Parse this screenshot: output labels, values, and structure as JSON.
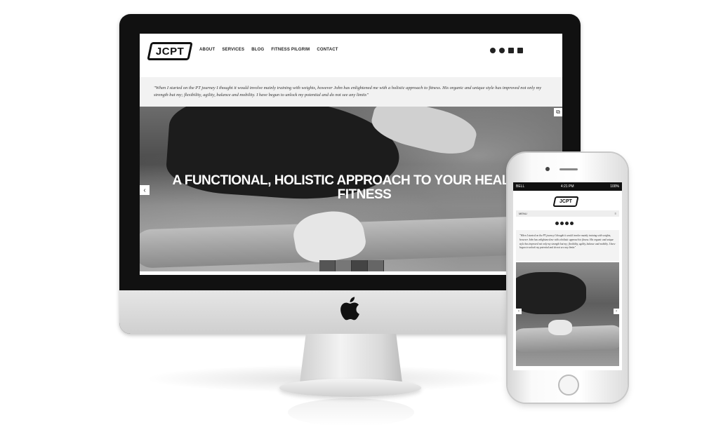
{
  "site": {
    "logo": "JCPT",
    "nav": [
      "ABOUT",
      "SERVICES",
      "BLOG",
      "FITNESS PILGRIM",
      "CONTACT"
    ],
    "social_icons": [
      "facebook-icon",
      "twitter-icon",
      "instagram-icon",
      "linkedin-icon"
    ],
    "quote": "\"When I started on the PT journey I thought it would involve mainly training with weights, however John has enlightened me with a holistic approach to fitness. His organic and unique style has improved not only my strength but my; flexibility, agility, balance and mobility. I have begun to unlock my potential and do not see any limits\"",
    "hero_title": "A FUNCTIONAL, HOLISTIC APPROACH TO YOUR HEALTH AND FITNESS"
  },
  "phone": {
    "carrier": "BELL",
    "time": "4:21 PM",
    "battery": "100%",
    "menu_label": "MENU",
    "logo": "JCPT",
    "quote": "\"When I started on the PT journey I thought it would involve mainly training with weights, however John has enlightened me with a holistic approach to fitness. His organic and unique style has improved not only my strength but my; flexibility, agility, balance and mobility. I have begun to unlock my potential and do not see any limits\""
  },
  "icons": {
    "prev": "‹",
    "next": "›",
    "expand": "⧉",
    "hamburger": "≡"
  }
}
